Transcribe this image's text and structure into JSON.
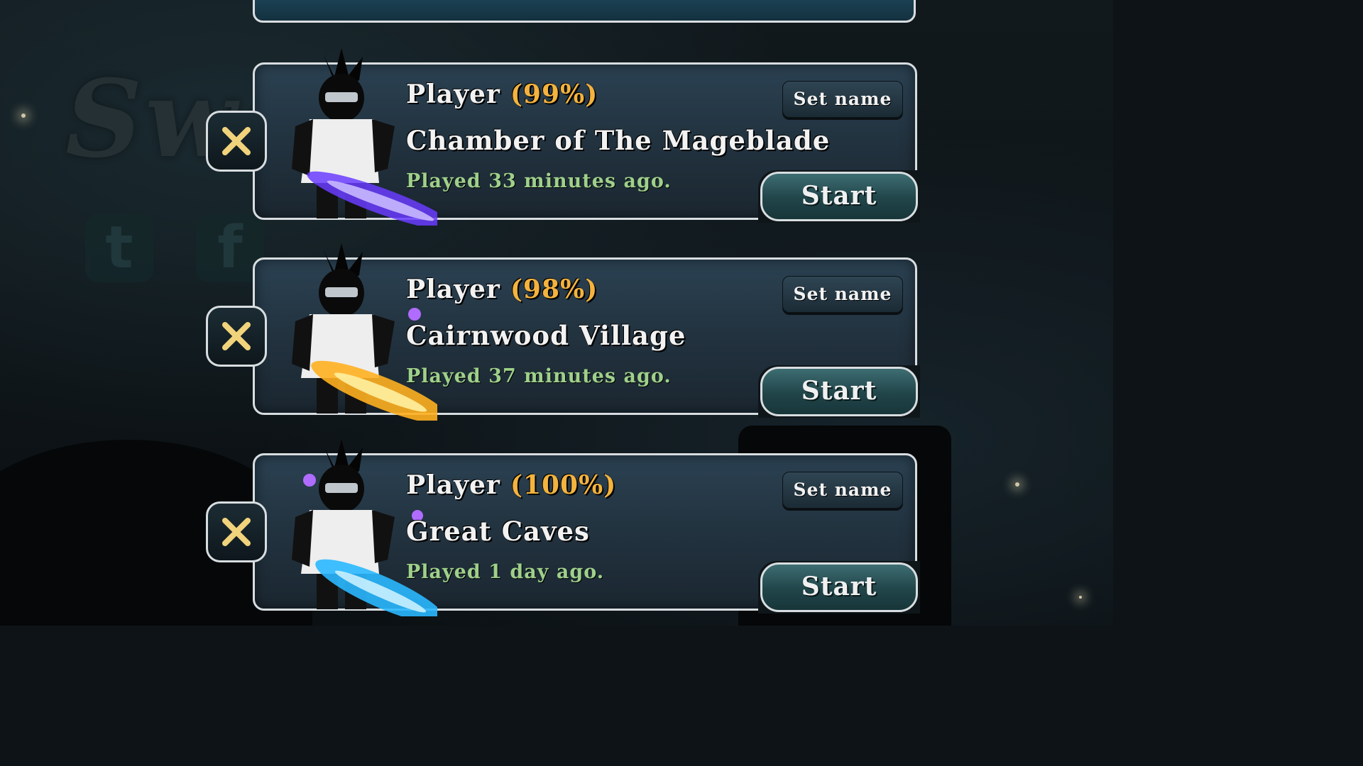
{
  "slots": [
    {
      "player": "Player",
      "progress": "(99%)",
      "location": "Chamber of The Mageblade",
      "played": "Played 33 minutes ago.",
      "set_name_label": "Set name",
      "start_label": "Start",
      "sword_color": "#6a3cff"
    },
    {
      "player": "Player",
      "progress": "(98%)",
      "location": "Cairnwood Village",
      "played": "Played 37 minutes ago.",
      "set_name_label": "Set name",
      "start_label": "Start",
      "sword_color": "#ffb020"
    },
    {
      "player": "Player",
      "progress": "(100%)",
      "location": "Great Caves",
      "played": "Played 1 day ago.",
      "set_name_label": "Set name",
      "start_label": "Start",
      "sword_color": "#2ab8ff"
    }
  ],
  "colors": {
    "accent_gold": "#f4b33e",
    "played_green": "#9fd08a",
    "close_x": "#f1d37c"
  },
  "background_icons": [
    "twitter-icon",
    "facebook-icon",
    "music-note-icon",
    "speaker-icon"
  ]
}
